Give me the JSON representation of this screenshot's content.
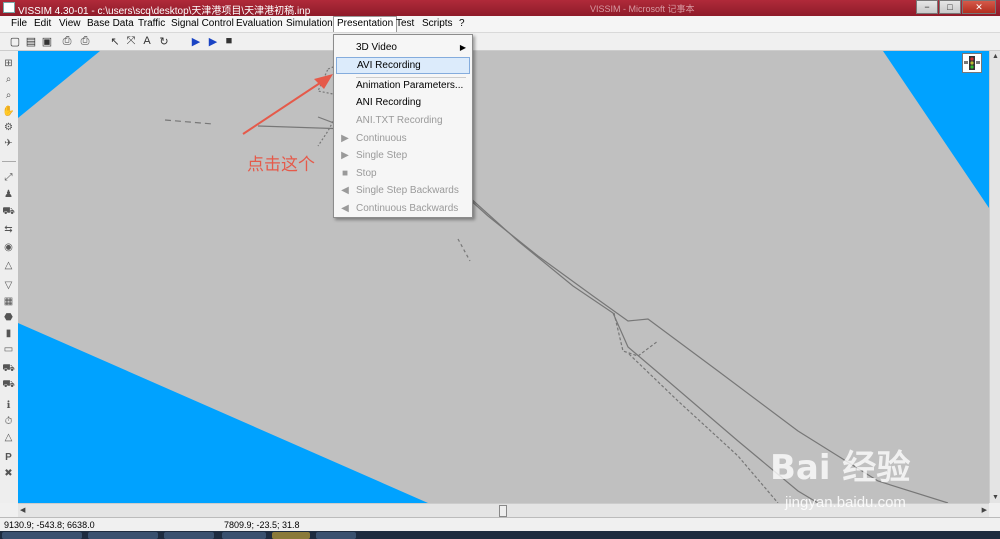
{
  "window": {
    "title": "VISSIM 4.30-01 - c:\\users\\scq\\desktop\\天津港项目\\天津港初稿.inp",
    "background_title": "VISSIM - Microsoft 记事本",
    "controls": {
      "minimize": "−",
      "maximize": "□",
      "close": "✕"
    }
  },
  "menubar": [
    {
      "label": "File"
    },
    {
      "label": "Edit"
    },
    {
      "label": "View"
    },
    {
      "label": "Base Data"
    },
    {
      "label": "Traffic"
    },
    {
      "label": "Signal Control"
    },
    {
      "label": "Evaluation"
    },
    {
      "label": "Simulation"
    },
    {
      "label": "Presentation",
      "active": true
    },
    {
      "label": "Test"
    },
    {
      "label": "Scripts"
    },
    {
      "label": "?"
    }
  ],
  "toolbar": [
    {
      "icon": "new-file-icon",
      "glyph": "▢"
    },
    {
      "icon": "open-folder-icon",
      "glyph": "▤"
    },
    {
      "icon": "save-icon",
      "glyph": "▣"
    },
    {
      "icon": "print-preview-icon",
      "glyph": "⎙"
    },
    {
      "icon": "print-icon",
      "glyph": "⎙"
    },
    {
      "icon": "select-arrow-icon",
      "glyph": "↖"
    },
    {
      "icon": "rotate-icon",
      "glyph": "⤧"
    },
    {
      "icon": "text-font-icon",
      "glyph": "A"
    },
    {
      "icon": "refresh-icon",
      "glyph": "↻"
    },
    {
      "icon": "play-icon",
      "glyph": "▶"
    },
    {
      "icon": "single-step-icon",
      "glyph": "▶"
    },
    {
      "icon": "stop-icon",
      "glyph": "■"
    }
  ],
  "left_toolbar": [
    {
      "icon": "network-view-icon",
      "glyph": "⊞"
    },
    {
      "icon": "zoom-in-icon",
      "glyph": "⌕"
    },
    {
      "icon": "zoom-out-icon",
      "glyph": "⌕"
    },
    {
      "icon": "pan-hand-icon",
      "glyph": "✋"
    },
    {
      "icon": "rotate-3d-icon",
      "glyph": "⚙"
    },
    {
      "icon": "plane-icon",
      "glyph": "✈"
    },
    {
      "icon": "links-icon",
      "glyph": "⤢"
    },
    {
      "icon": "pedestrian-icon",
      "glyph": "♟"
    },
    {
      "icon": "vehicle-input-icon",
      "glyph": "⛟"
    },
    {
      "icon": "routes-icon",
      "glyph": "⇆"
    },
    {
      "icon": "speed-decision-icon",
      "glyph": "◉"
    },
    {
      "icon": "reduced-speed-icon",
      "glyph": "△"
    },
    {
      "icon": "priority-rule-icon",
      "glyph": "▽"
    },
    {
      "icon": "conflict-area-icon",
      "glyph": "▦"
    },
    {
      "icon": "stop-sign-icon",
      "glyph": "⬣"
    },
    {
      "icon": "signal-head-icon",
      "glyph": "▮"
    },
    {
      "icon": "detector-icon",
      "glyph": "▭"
    },
    {
      "icon": "bus-stop-icon",
      "glyph": "⛟"
    },
    {
      "icon": "pt-line-icon",
      "glyph": "⛟"
    },
    {
      "icon": "info-icon",
      "glyph": "ℹ"
    },
    {
      "icon": "timer-icon",
      "glyph": "⏱"
    },
    {
      "icon": "warning-icon",
      "glyph": "△"
    },
    {
      "icon": "parking-icon",
      "glyph": "P"
    },
    {
      "icon": "node-icon",
      "glyph": "✖"
    }
  ],
  "dropdown": {
    "items": [
      {
        "label": "3D Video",
        "underline": "3",
        "rest": "D Video",
        "submenu": true,
        "enabled": true
      },
      {
        "label": "AVI Recording",
        "underline": "AV",
        "rest": "I Recording",
        "enabled": true,
        "highlight": true
      },
      {
        "label": "Animation Parameters...",
        "underline": "A",
        "rest": "nimation Parameters...",
        "enabled": true
      },
      {
        "label": "ANI Recording",
        "underline": "A",
        "rest": "NI Recording",
        "enabled": true
      },
      {
        "label": "ANI.TXT Recording",
        "underline": "",
        "rest": "ANI.TXT Recording",
        "enabled": false
      },
      {
        "label": "Continuous",
        "underline": "C",
        "rest": "ontinuous",
        "enabled": false,
        "glyph": "▶"
      },
      {
        "label": "Single Step",
        "underline": "S",
        "rest": "ingle Step",
        "enabled": false,
        "glyph": "▶"
      },
      {
        "label": "Stop",
        "underline": "S",
        "rest": "top",
        "enabled": false,
        "glyph": "■"
      },
      {
        "label": "Single Step Backwards",
        "underline": "S",
        "rest": "ingle Step Backwards",
        "enabled": false,
        "glyph": "◀"
      },
      {
        "label": "Continuous Backwards",
        "underline": "C",
        "rest": "ontinuous Backwards",
        "enabled": false,
        "glyph": "◀"
      }
    ]
  },
  "annotation": {
    "text": "点击这个"
  },
  "status": {
    "coords_left": "9130.9; -543.8; 6638.0",
    "coords_right": "7809.9; -23.5; 31.8"
  },
  "watermark": {
    "brand": "Bai  经验",
    "url": "jingyan.baidu.com"
  },
  "colors": {
    "title_bar": "#a1212f",
    "canvas_sky": "#00a2ff",
    "ground_plane": "#c0c0c0",
    "annotation": "#e55a4a",
    "highlight": "#dcebfb"
  }
}
